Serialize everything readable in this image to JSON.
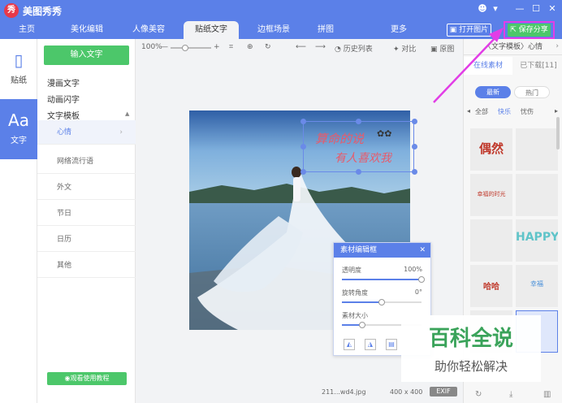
{
  "app": {
    "logo_char": "秀",
    "title": "美图秀秀",
    "window_controls": [
      "☻",
      "▾",
      "—",
      "☐",
      "✕"
    ]
  },
  "nav": {
    "tabs": [
      "主页",
      "美化编辑",
      "人像美容",
      "贴纸文字",
      "边框场景",
      "拼图",
      "更多"
    ],
    "active_tab": "贴纸文字",
    "open_image": "打开图片",
    "save_share": "保存分享",
    "highlight_color": "#e23de6"
  },
  "sidebar": {
    "items": [
      {
        "icon": "bookmark-icon",
        "glyph": "▯",
        "label": "贴纸"
      },
      {
        "icon": "text-icon",
        "glyph": "Aa",
        "label": "文字"
      }
    ],
    "active": "文字"
  },
  "categories": {
    "input_text_button": "输入文字",
    "top": [
      "漫画文字",
      "动画闪字",
      "文字模板"
    ],
    "collapse_glyph": "▲",
    "subcategories": [
      "心情",
      "网络流行语",
      "外文",
      "节日",
      "日历",
      "其他"
    ],
    "selected_sub": "心情",
    "tutorial": "观看使用教程"
  },
  "toolbar": {
    "zoom": "100%",
    "history": "历史列表",
    "compare": "对比",
    "original": "原图"
  },
  "canvas": {
    "sticker_line1": "算命的说",
    "sticker_line2": "有人喜欢我",
    "sticker_color": "#e85a6a"
  },
  "edit_panel": {
    "title": "素材编辑框",
    "sliders": [
      {
        "label": "透明度",
        "value": "100%",
        "fraction": 1.0
      },
      {
        "label": "旋转角度",
        "value": "0°",
        "fraction": 0.5
      },
      {
        "label": "素材大小",
        "value": "",
        "fraction": 0.25
      }
    ]
  },
  "status": {
    "filename": "211...wd4.jpg",
    "dimensions": "400 x 400",
    "exif": "EXIF"
  },
  "right_panel": {
    "header": "〈文字模板〉心情",
    "tabs": [
      "在线素材",
      "已下载[11]"
    ],
    "sort": [
      "最新",
      "热门"
    ],
    "subtabs": [
      "全部",
      "快乐",
      "忧伤"
    ],
    "active_subtab": "快乐",
    "thumbnails": [
      {
        "text": "偶然",
        "color": "#c0392b"
      },
      {
        "text": "",
        "color": "#e28a9a"
      },
      {
        "text": "幸福的时光",
        "color": "#c0392b"
      },
      {
        "text": "",
        "color": "#4a90d9"
      },
      {
        "text": "",
        "color": "#e28a9a"
      },
      {
        "text": "HAPPY",
        "color": "#5fc4c9"
      },
      {
        "text": "哈哈",
        "color": "#c0392b"
      },
      {
        "text": "幸福",
        "color": "#4a90d9"
      },
      {
        "text": "",
        "color": "#888888"
      },
      {
        "text": "",
        "color": "#888888"
      }
    ]
  },
  "watermark": {
    "title": "百科全说",
    "subtitle": "助你轻松解决"
  },
  "colors": {
    "brand_blue": "#5b80e8",
    "green": "#4cc76a"
  }
}
